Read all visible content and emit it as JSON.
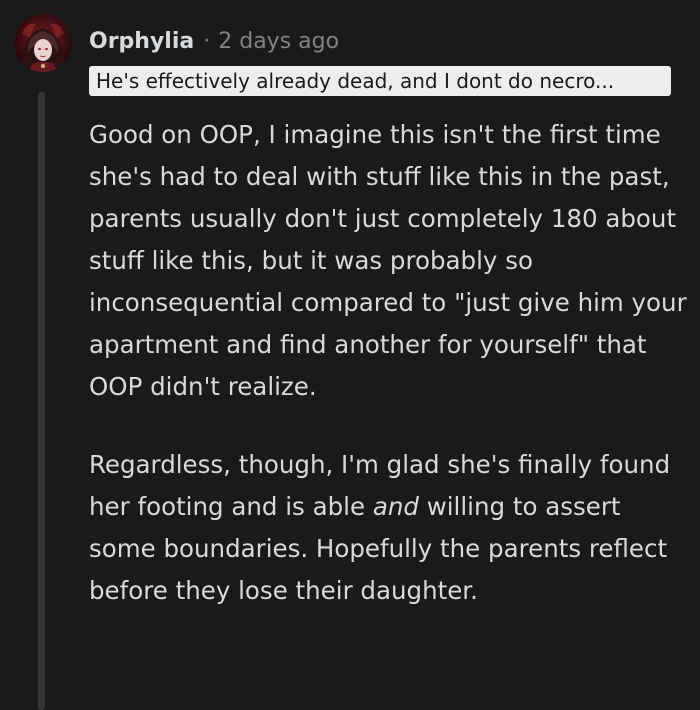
{
  "comment": {
    "author": "Orphylia",
    "separator": "·",
    "timestamp": "2 days ago",
    "flair": "He's effectively already dead, and I dont do necro...",
    "avatar_icon": "user-avatar-icon",
    "colors": {
      "background": "#1a1a1b",
      "text": "#d7dadc",
      "meta": "#818384",
      "flair_bg": "#ededed",
      "thread_line": "#343536"
    },
    "paragraphs": [
      {
        "text": "Good on OOP, I imagine this isn't the first time she's had to deal with stuff like this in the past, parents usually don't just completely 180 about stuff like this, but it was probably so inconsequential compared to \"just give him your apartment and find another for yourself\" that OOP didn't realize."
      },
      {
        "before": "Regardless, though, I'm glad she's finally found her footing and is able ",
        "emphasis": "and",
        "after": " willing to assert some boundaries. Hopefully the parents reflect before they lose their daughter."
      }
    ]
  }
}
